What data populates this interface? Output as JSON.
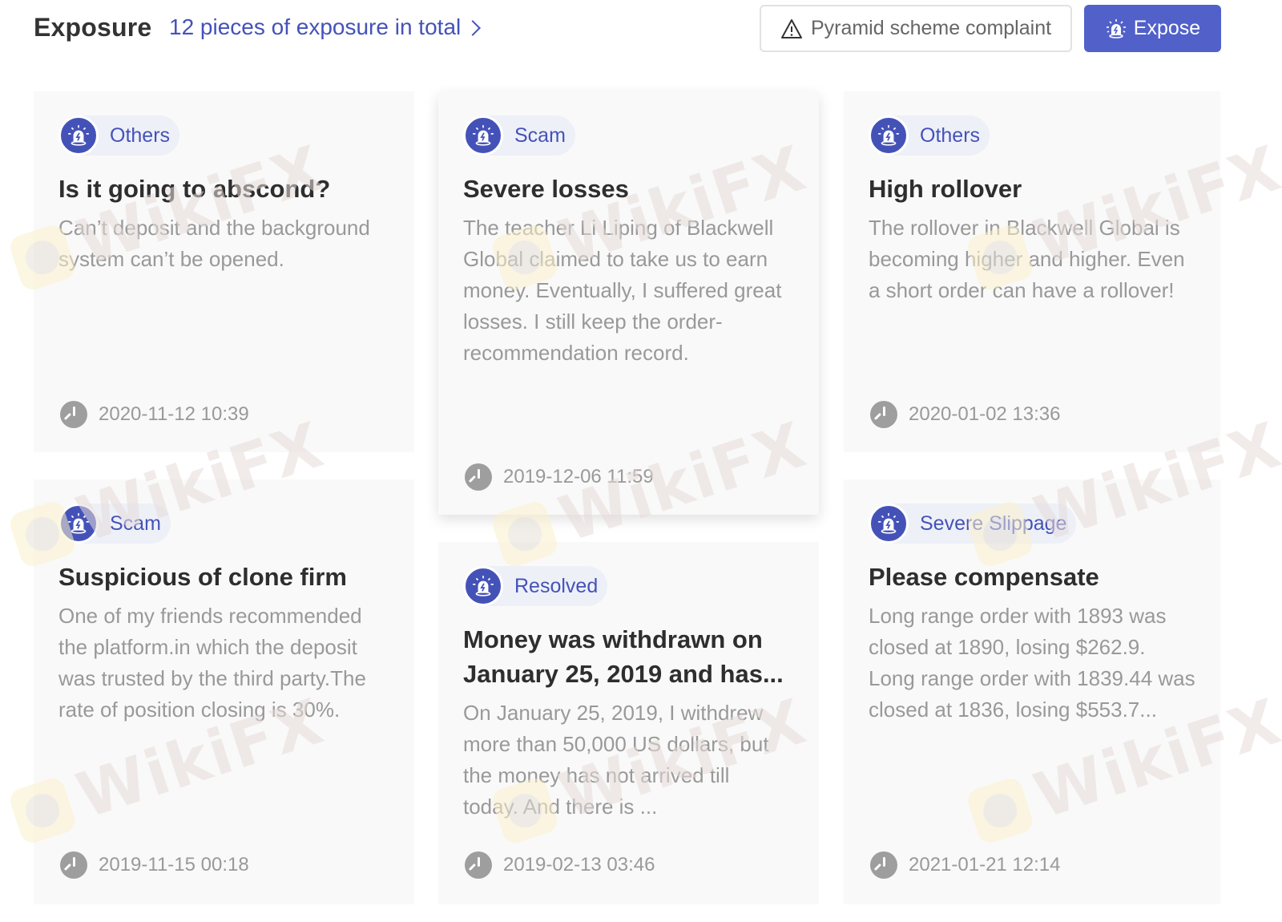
{
  "header": {
    "title": "Exposure",
    "total_link": "12 pieces of exposure in total",
    "complaint_button": "Pyramid scheme complaint",
    "expose_button": "Expose"
  },
  "colors": {
    "accent": "#4452b8",
    "button_primary": "#5161c9",
    "card_bg": "#f9f9f9",
    "badge_bg": "#eef0f8",
    "muted_text": "#999999"
  },
  "watermark": "WikiFX",
  "cards": [
    {
      "tag": "Others",
      "title": "Is it going to abscond?",
      "body": "Can’t deposit and the background system can’t be opened.",
      "time": "2020-11-12 10:39"
    },
    {
      "tag": "Scam",
      "title": "Severe losses",
      "body": "The teacher Li Liping of Blackwell Global claimed to take us to earn money. Eventually, I suffered great losses. I still keep the order-recommendation record.",
      "time": "2019-12-06 11:59"
    },
    {
      "tag": "Others",
      "title": "High rollover",
      "body": "The rollover in Blackwell Global is becoming higher and higher. Even a short order can have a rollover!",
      "time": "2020-01-02 13:36"
    },
    {
      "tag": "Scam",
      "title": "Suspicious of clone firm",
      "body": "One of my friends recommended the platform.in which the deposit was trusted by the third party.The rate of position closing is 30%.",
      "time": "2019-11-15 00:18"
    },
    {
      "tag": "Resolved",
      "title": "Money was withdrawn on January 25, 2019 and has...",
      "body": "On January 25, 2019, I withdrew more than 50,000 US dollars, but the money has not arrived till today. And there is ...",
      "time": "2019-02-13 03:46"
    },
    {
      "tag": "Severe Slippage",
      "title": "Please compensate",
      "body": "Long range order with 1893 was closed at 1890, losing $262.9.\nLong range order with 1839.44 was closed at 1836, losing $553.7...",
      "time": "2021-01-21 12:14"
    }
  ]
}
